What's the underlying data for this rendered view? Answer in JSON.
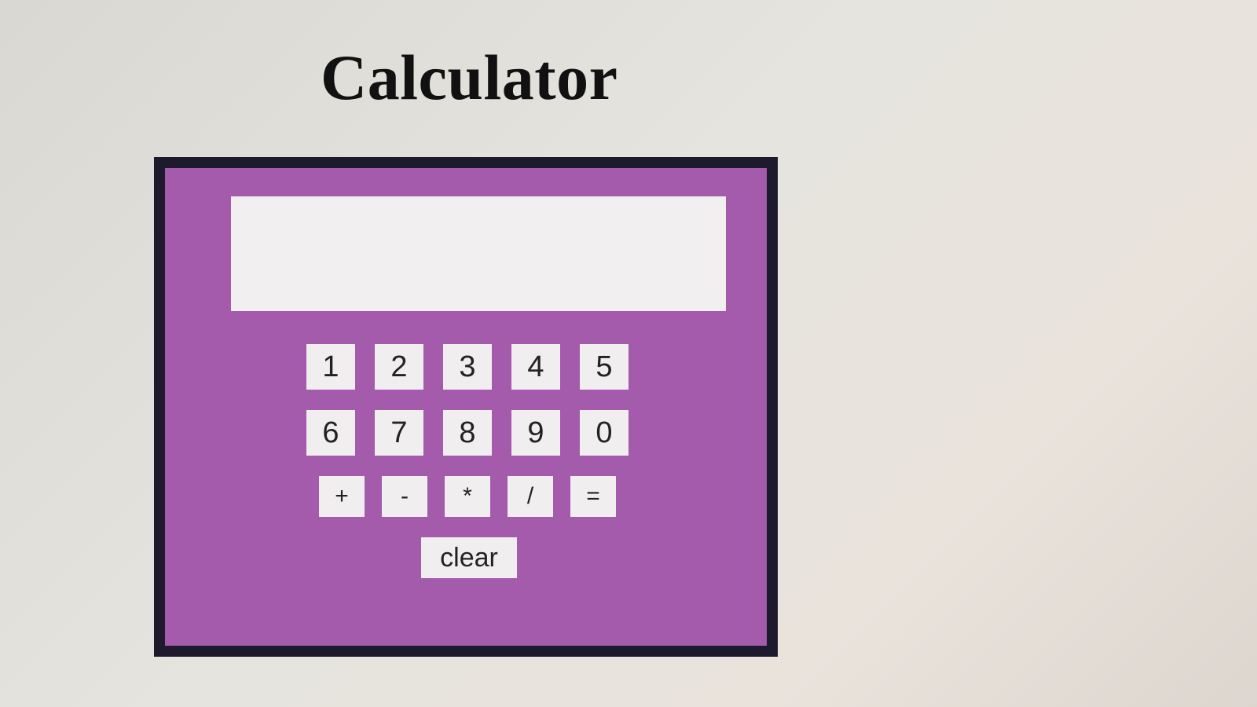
{
  "page": {
    "title": "Calculator"
  },
  "calculator": {
    "display_value": "",
    "colors": {
      "body": "#a45bab",
      "frame": "#1e1a2e",
      "display": "#f1efef",
      "key": "#f0eeee"
    },
    "digit_rows": [
      [
        "1",
        "2",
        "3",
        "4",
        "5"
      ],
      [
        "6",
        "7",
        "8",
        "9",
        "0"
      ]
    ],
    "operators": [
      "+",
      "-",
      "*",
      "/",
      "="
    ],
    "clear_label": "clear"
  }
}
